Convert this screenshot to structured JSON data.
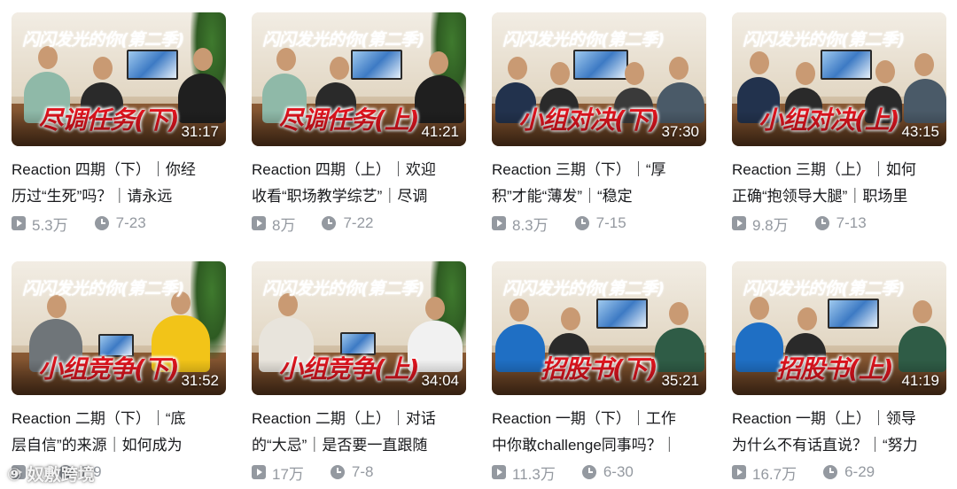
{
  "videos": [
    {
      "thumb_title": "闪闪发光的你(第二季)",
      "thumb_big": "尽调任务(下)",
      "duration": "31:17",
      "line1": "Reaction 四期（下）｜你经",
      "line2": "历过“生死”吗？｜请永远",
      "views": "5.3万",
      "date": "7-23"
    },
    {
      "thumb_title": "闪闪发光的你(第二季)",
      "thumb_big": "尽调任务(上)",
      "duration": "41:21",
      "line1": "Reaction 四期（上）｜欢迎",
      "line2": "收看“职场教学综艺”｜尽调",
      "views": "8万",
      "date": "7-22"
    },
    {
      "thumb_title": "闪闪发光的你(第二季)",
      "thumb_big": "小组对决(下)",
      "duration": "37:30",
      "line1": "Reaction 三期（下）｜“厚",
      "line2": "积”才能“薄发”｜“稳定",
      "views": "8.3万",
      "date": "7-15"
    },
    {
      "thumb_title": "闪闪发光的你(第二季)",
      "thumb_big": "小组对决(上)",
      "duration": "43:15",
      "line1": "Reaction 三期（上）｜如何",
      "line2": "正确“抱领导大腿”｜职场里",
      "views": "9.8万",
      "date": "7-13"
    },
    {
      "thumb_title": "闪闪发光的你(第二季)",
      "thumb_big": "小组竞争(下)",
      "duration": "31:52",
      "line1": "Reaction 二期（下）｜“底",
      "line2": "层自信”的来源｜如何成为",
      "views": "",
      "date": "7-9"
    },
    {
      "thumb_title": "闪闪发光的你(第二季)",
      "thumb_big": "小组竞争(上)",
      "duration": "34:04",
      "line1": "Reaction 二期（上）｜对话",
      "line2": "的“大忌”｜是否要一直跟随",
      "views": "17万",
      "date": "7-8"
    },
    {
      "thumb_title": "闪闪发光的你(第二季)",
      "thumb_big": "招股书(下)",
      "duration": "35:21",
      "line1": "Reaction 一期（下）｜工作",
      "line2": "中你敢challenge同事吗？｜",
      "views": "11.3万",
      "date": "6-30"
    },
    {
      "thumb_title": "闪闪发光的你(第二季)",
      "thumb_big": "招股书(上)",
      "duration": "41:19",
      "line1": "Reaction 一期（上）｜领导",
      "line2": "为什么不有话直说？｜“努力",
      "views": "16.7万",
      "date": "6-29"
    }
  ],
  "watermark": "⑨ 奴敷跨境",
  "colors": {
    "accent_red": "#e0141e",
    "meta_gray": "#9499a0"
  }
}
